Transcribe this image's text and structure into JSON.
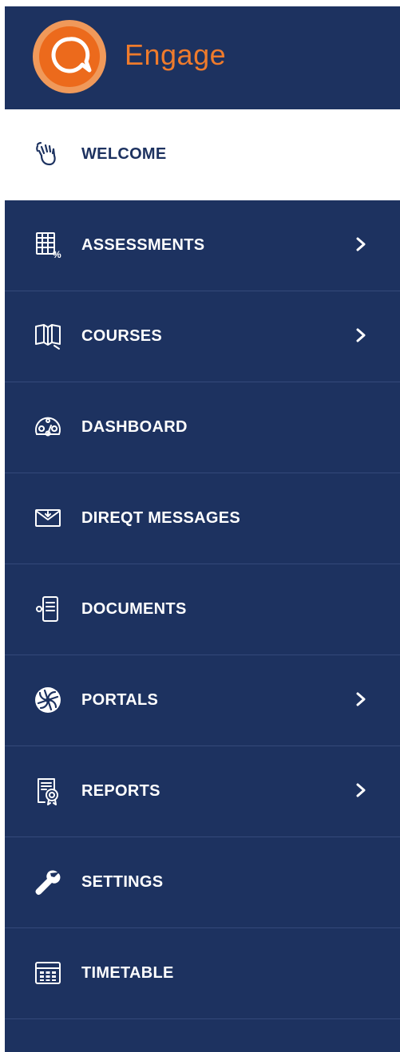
{
  "brand": {
    "name": "Engage",
    "logo_icon": "engage-logo-icon",
    "color": "#ef7b2c"
  },
  "colors": {
    "sidebar_bg": "#1d3260",
    "active_bg": "#ffffff",
    "separator": "#34497a"
  },
  "menu": {
    "items": [
      {
        "label": "WELCOME",
        "icon": "waving-hand-icon",
        "active": true,
        "has_submenu": false
      },
      {
        "label": "ASSESSMENTS",
        "icon": "grid-percent-icon",
        "active": false,
        "has_submenu": true
      },
      {
        "label": "COURSES",
        "icon": "open-book-icon",
        "active": false,
        "has_submenu": true
      },
      {
        "label": "DASHBOARD",
        "icon": "speedometer-icon",
        "active": false,
        "has_submenu": false
      },
      {
        "label": "DIREQT MESSAGES",
        "icon": "envelope-icon",
        "active": false,
        "has_submenu": false
      },
      {
        "label": "DOCUMENTS",
        "icon": "document-icon",
        "active": false,
        "has_submenu": false
      },
      {
        "label": "PORTALS",
        "icon": "portal-swirl-icon",
        "active": false,
        "has_submenu": true
      },
      {
        "label": "REPORTS",
        "icon": "report-badge-icon",
        "active": false,
        "has_submenu": true
      },
      {
        "label": "SETTINGS",
        "icon": "wrench-icon",
        "active": false,
        "has_submenu": false
      },
      {
        "label": "TIMETABLE",
        "icon": "calendar-grid-icon",
        "active": false,
        "has_submenu": false
      }
    ]
  }
}
